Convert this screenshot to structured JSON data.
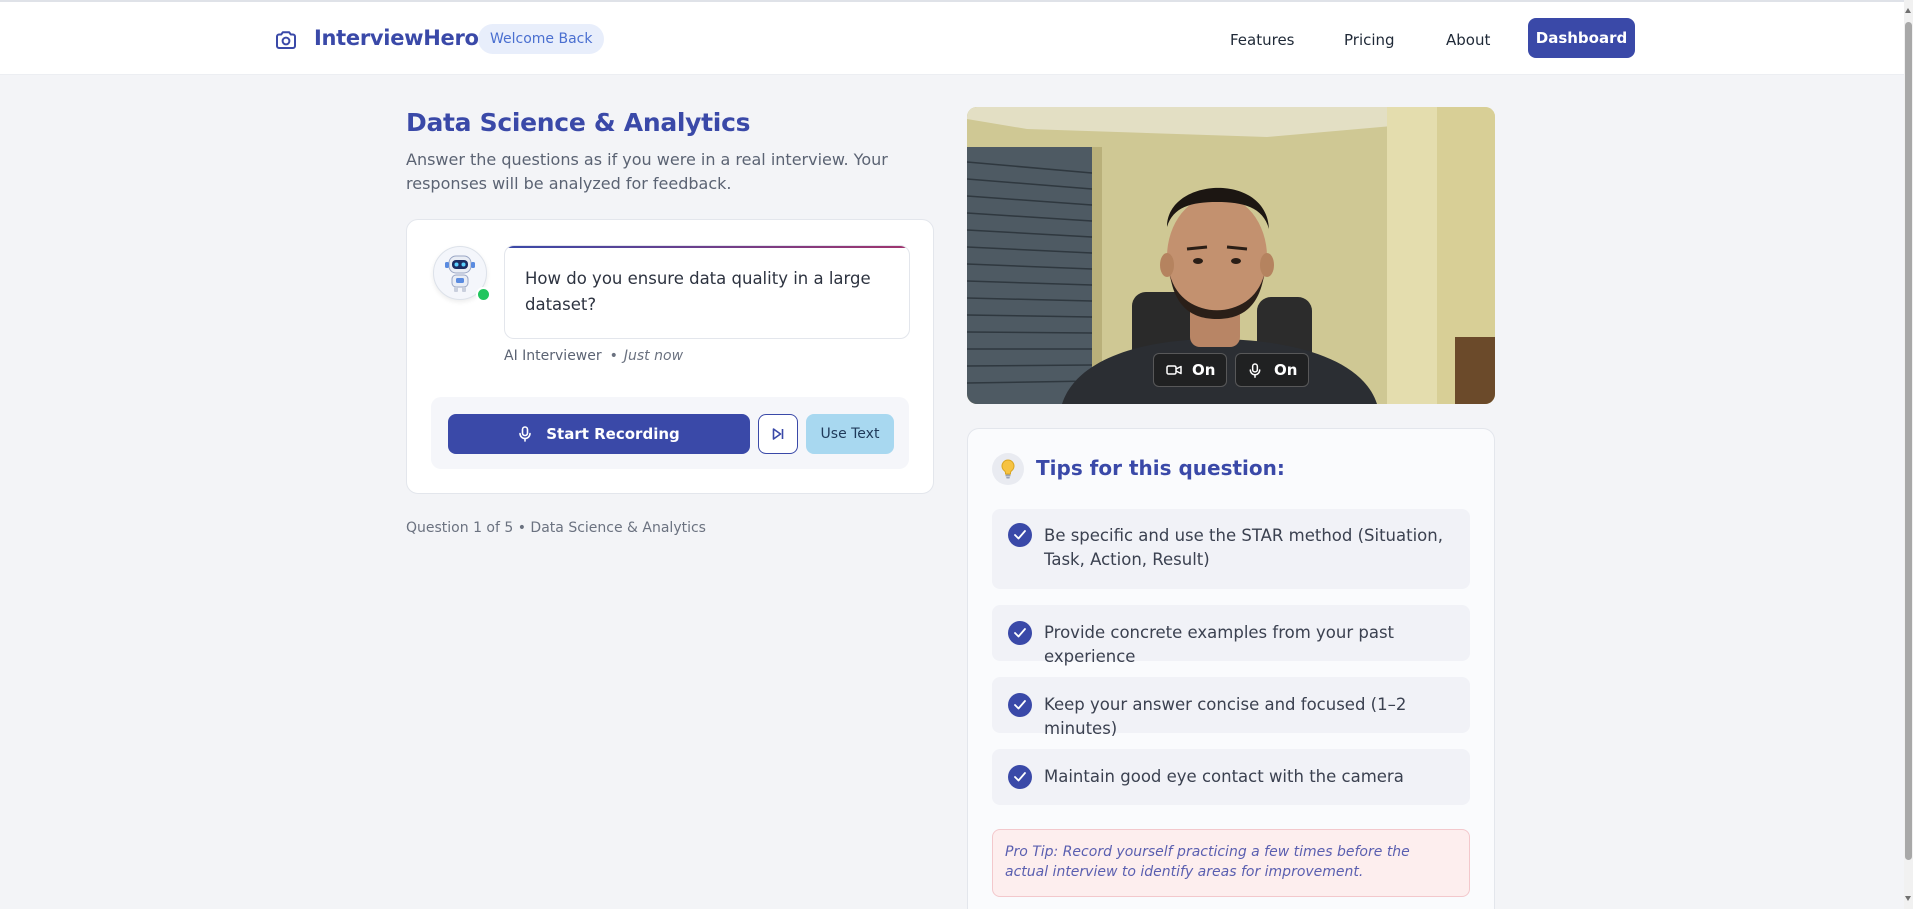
{
  "brand": {
    "name": "InterviewHero",
    "badge": "Welcome Back"
  },
  "nav": {
    "links": [
      "Features",
      "Pricing",
      "About"
    ],
    "dashboard": "Dashboard"
  },
  "session": {
    "title": "Data Science & Analytics",
    "subtitle": "Answer the questions as if you were in a real interview. Your responses will be analyzed for feedback."
  },
  "chat": {
    "question": "How do you ensure data quality in a large dataset?",
    "author": "AI Interviewer",
    "time": "Just now"
  },
  "actions": {
    "record": "Start Recording",
    "text": "Use Text"
  },
  "progress": "Question 1 of 5 • Data Science & Analytics",
  "video": {
    "camera_status": "On",
    "mic_status": "On"
  },
  "tips": {
    "title": "Tips for this question:",
    "items": [
      "Be specific and use the STAR method (Situation, Task, Action, Result)",
      "Provide concrete examples from your past experience",
      "Keep your answer concise and focused (1–2 minutes)",
      "Maintain good eye contact with the camera"
    ],
    "pro_tip": "Pro Tip: Record yourself practicing a few times before the actual interview to identify areas for improvement."
  },
  "colors": {
    "primary": "#3a49a8",
    "badge_bg": "#e8eefb",
    "use_text_bg": "#a8d8f0",
    "online": "#22c55e",
    "pro_tip_bg": "#fdeeee"
  },
  "icons": [
    "camera-icon",
    "mic-icon",
    "skip-icon",
    "video-icon",
    "bulb-icon",
    "check-icon",
    "robot-avatar"
  ]
}
